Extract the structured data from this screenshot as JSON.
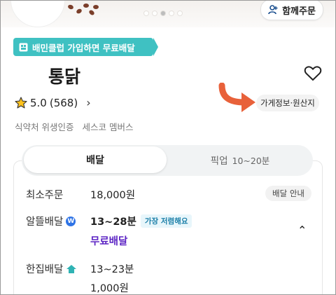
{
  "header": {
    "group_order_label": "함께주문",
    "carousel_dots": 5,
    "active_dot": 2
  },
  "club_banner": {
    "text": "배민클럽 가입하면 무료배달"
  },
  "store": {
    "name": "통닭",
    "rating": "5.0",
    "review_count": "(568)",
    "info_button": "가게정보·원산지",
    "badges": [
      "식약처 위생인증",
      "세스코 멤버스"
    ]
  },
  "tabs": {
    "delivery": "배달",
    "pickup": "픽업",
    "pickup_time": "10~20분"
  },
  "details": {
    "min_order_label": "최소주문",
    "min_order_value": "18,000원",
    "delivery_guide": "배달 안내",
    "saver_label": "알뜰배달",
    "saver_time": "13~28분",
    "saver_badge": "가장 저렴해요",
    "saver_fee": "무료배달",
    "single_label": "한집배달",
    "single_time": "13~23분",
    "single_fee": "1,000원"
  },
  "colors": {
    "club_teal": "#3fc1c2",
    "free_delivery_purple": "#5b23c4",
    "arrow_orange": "#e8613a",
    "badge_blue": "#1b7fa8"
  }
}
